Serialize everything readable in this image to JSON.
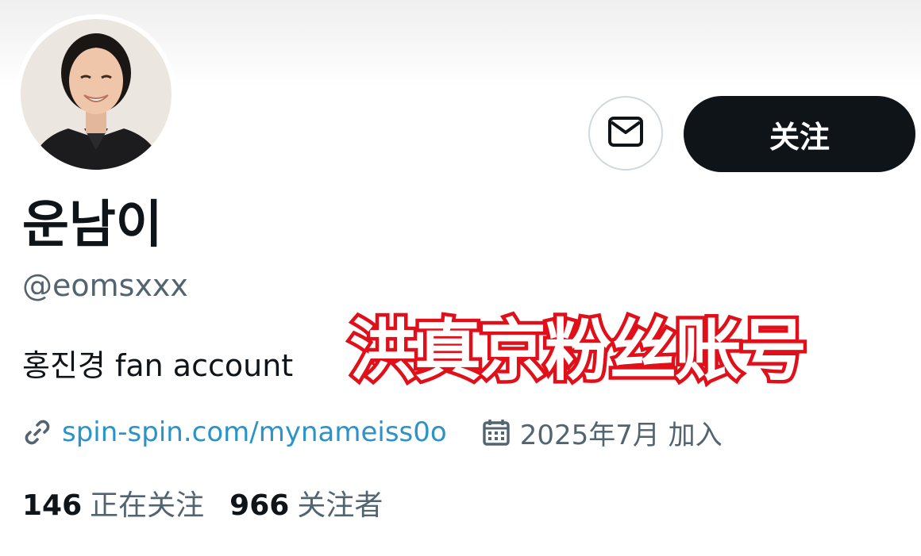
{
  "profile": {
    "display_name": "운남이",
    "handle": "@eomsxxx",
    "bio": "홍진경 fan account",
    "link": "spin-spin.com/mynameiss0o",
    "joined": "2025年7月 加入"
  },
  "actions": {
    "message_icon": "envelope-icon",
    "follow_label": "关注"
  },
  "stats": {
    "following_count": "146",
    "following_label": "正在关注",
    "followers_count": "966",
    "followers_label": "关注者"
  },
  "overlay": {
    "caption": "洪真京粉丝账号"
  },
  "icons": {
    "link": "link-icon",
    "calendar": "calendar-icon"
  },
  "colors": {
    "primary_button": "#0f1419",
    "link": "#2a93c9",
    "secondary_text": "#536471",
    "overlay_stroke": "#e0101a"
  }
}
